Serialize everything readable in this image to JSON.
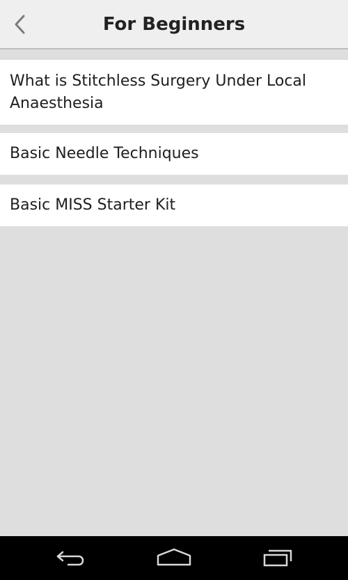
{
  "header": {
    "title": "For Beginners",
    "back_icon": "chevron-left-icon"
  },
  "list": {
    "items": [
      {
        "label": "What is Stitchless Surgery Under Local Anaesthesia"
      },
      {
        "label": "Basic Needle Techniques"
      },
      {
        "label": "Basic MISS Starter Kit"
      }
    ]
  },
  "navbar": {
    "back_icon": "nav-back-icon",
    "home_icon": "nav-home-icon",
    "recents_icon": "nav-recents-icon"
  },
  "colors": {
    "header_bg": "#efefef",
    "content_bg": "#dedede",
    "item_bg": "#ffffff",
    "navbar_bg": "#000000",
    "text": "#1e1e1e"
  }
}
